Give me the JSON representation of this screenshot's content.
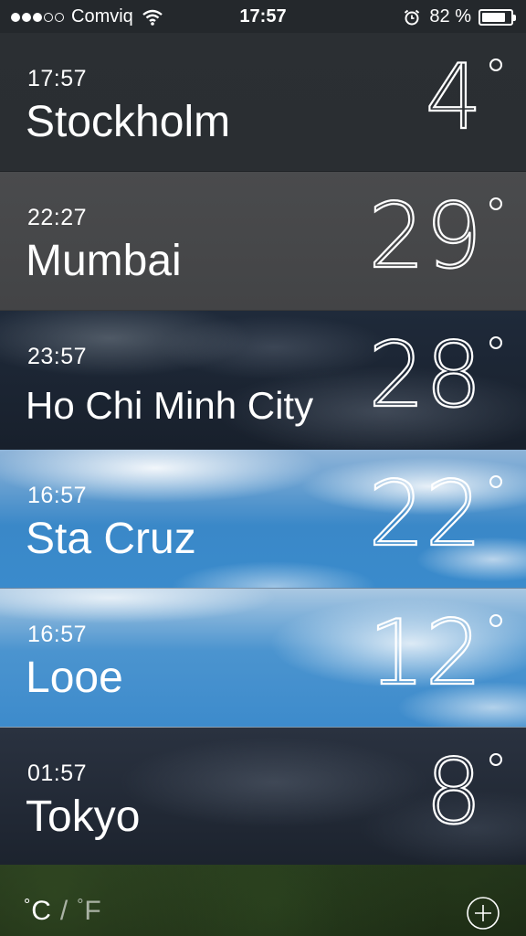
{
  "status_bar": {
    "signal_full": 3,
    "signal_empty": 2,
    "carrier": "Comviq",
    "time": "17:57",
    "battery_percent_text": "82 %",
    "battery_level": 0.82
  },
  "cities": [
    {
      "time": "17:57",
      "name": "Stockholm",
      "temp": "4"
    },
    {
      "time": "22:27",
      "name": "Mumbai",
      "temp": "29"
    },
    {
      "time": "23:57",
      "name": "Ho Chi Minh City",
      "temp": "28"
    },
    {
      "time": "16:57",
      "name": "Sta Cruz",
      "temp": "22"
    },
    {
      "time": "16:57",
      "name": "Looe",
      "temp": "12"
    },
    {
      "time": "01:57",
      "name": "Tokyo",
      "temp": "8"
    }
  ],
  "toolbar": {
    "celsius_label": "C",
    "separator": "/",
    "fahrenheit_label": "F",
    "degree_symbol": "°",
    "add_icon": "plus-circle-icon"
  },
  "colors": {
    "text": "#ffffff",
    "sky_blue": "#3a8bcc",
    "dark_row": "#2a2e32"
  }
}
